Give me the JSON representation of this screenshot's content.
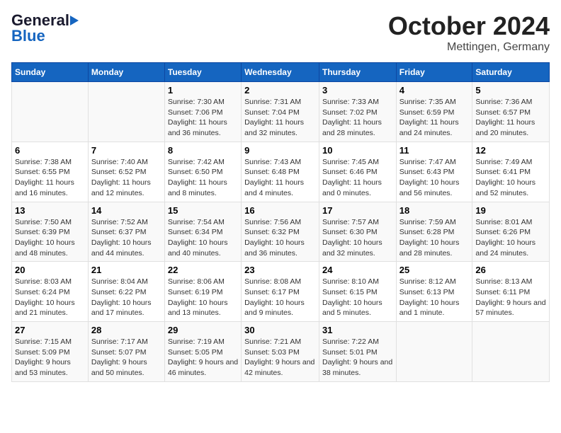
{
  "header": {
    "logo": {
      "general": "General",
      "blue": "Blue"
    },
    "month": "October 2024",
    "location": "Mettingen, Germany"
  },
  "days_of_week": [
    "Sunday",
    "Monday",
    "Tuesday",
    "Wednesday",
    "Thursday",
    "Friday",
    "Saturday"
  ],
  "weeks": [
    [
      {
        "day": "",
        "info": ""
      },
      {
        "day": "",
        "info": ""
      },
      {
        "day": "1",
        "info": "Sunrise: 7:30 AM\nSunset: 7:06 PM\nDaylight: 11 hours and 36 minutes."
      },
      {
        "day": "2",
        "info": "Sunrise: 7:31 AM\nSunset: 7:04 PM\nDaylight: 11 hours and 32 minutes."
      },
      {
        "day": "3",
        "info": "Sunrise: 7:33 AM\nSunset: 7:02 PM\nDaylight: 11 hours and 28 minutes."
      },
      {
        "day": "4",
        "info": "Sunrise: 7:35 AM\nSunset: 6:59 PM\nDaylight: 11 hours and 24 minutes."
      },
      {
        "day": "5",
        "info": "Sunrise: 7:36 AM\nSunset: 6:57 PM\nDaylight: 11 hours and 20 minutes."
      }
    ],
    [
      {
        "day": "6",
        "info": "Sunrise: 7:38 AM\nSunset: 6:55 PM\nDaylight: 11 hours and 16 minutes."
      },
      {
        "day": "7",
        "info": "Sunrise: 7:40 AM\nSunset: 6:52 PM\nDaylight: 11 hours and 12 minutes."
      },
      {
        "day": "8",
        "info": "Sunrise: 7:42 AM\nSunset: 6:50 PM\nDaylight: 11 hours and 8 minutes."
      },
      {
        "day": "9",
        "info": "Sunrise: 7:43 AM\nSunset: 6:48 PM\nDaylight: 11 hours and 4 minutes."
      },
      {
        "day": "10",
        "info": "Sunrise: 7:45 AM\nSunset: 6:46 PM\nDaylight: 11 hours and 0 minutes."
      },
      {
        "day": "11",
        "info": "Sunrise: 7:47 AM\nSunset: 6:43 PM\nDaylight: 10 hours and 56 minutes."
      },
      {
        "day": "12",
        "info": "Sunrise: 7:49 AM\nSunset: 6:41 PM\nDaylight: 10 hours and 52 minutes."
      }
    ],
    [
      {
        "day": "13",
        "info": "Sunrise: 7:50 AM\nSunset: 6:39 PM\nDaylight: 10 hours and 48 minutes."
      },
      {
        "day": "14",
        "info": "Sunrise: 7:52 AM\nSunset: 6:37 PM\nDaylight: 10 hours and 44 minutes."
      },
      {
        "day": "15",
        "info": "Sunrise: 7:54 AM\nSunset: 6:34 PM\nDaylight: 10 hours and 40 minutes."
      },
      {
        "day": "16",
        "info": "Sunrise: 7:56 AM\nSunset: 6:32 PM\nDaylight: 10 hours and 36 minutes."
      },
      {
        "day": "17",
        "info": "Sunrise: 7:57 AM\nSunset: 6:30 PM\nDaylight: 10 hours and 32 minutes."
      },
      {
        "day": "18",
        "info": "Sunrise: 7:59 AM\nSunset: 6:28 PM\nDaylight: 10 hours and 28 minutes."
      },
      {
        "day": "19",
        "info": "Sunrise: 8:01 AM\nSunset: 6:26 PM\nDaylight: 10 hours and 24 minutes."
      }
    ],
    [
      {
        "day": "20",
        "info": "Sunrise: 8:03 AM\nSunset: 6:24 PM\nDaylight: 10 hours and 21 minutes."
      },
      {
        "day": "21",
        "info": "Sunrise: 8:04 AM\nSunset: 6:22 PM\nDaylight: 10 hours and 17 minutes."
      },
      {
        "day": "22",
        "info": "Sunrise: 8:06 AM\nSunset: 6:19 PM\nDaylight: 10 hours and 13 minutes."
      },
      {
        "day": "23",
        "info": "Sunrise: 8:08 AM\nSunset: 6:17 PM\nDaylight: 10 hours and 9 minutes."
      },
      {
        "day": "24",
        "info": "Sunrise: 8:10 AM\nSunset: 6:15 PM\nDaylight: 10 hours and 5 minutes."
      },
      {
        "day": "25",
        "info": "Sunrise: 8:12 AM\nSunset: 6:13 PM\nDaylight: 10 hours and 1 minute."
      },
      {
        "day": "26",
        "info": "Sunrise: 8:13 AM\nSunset: 6:11 PM\nDaylight: 9 hours and 57 minutes."
      }
    ],
    [
      {
        "day": "27",
        "info": "Sunrise: 7:15 AM\nSunset: 5:09 PM\nDaylight: 9 hours and 53 minutes."
      },
      {
        "day": "28",
        "info": "Sunrise: 7:17 AM\nSunset: 5:07 PM\nDaylight: 9 hours and 50 minutes."
      },
      {
        "day": "29",
        "info": "Sunrise: 7:19 AM\nSunset: 5:05 PM\nDaylight: 9 hours and 46 minutes."
      },
      {
        "day": "30",
        "info": "Sunrise: 7:21 AM\nSunset: 5:03 PM\nDaylight: 9 hours and 42 minutes."
      },
      {
        "day": "31",
        "info": "Sunrise: 7:22 AM\nSunset: 5:01 PM\nDaylight: 9 hours and 38 minutes."
      },
      {
        "day": "",
        "info": ""
      },
      {
        "day": "",
        "info": ""
      }
    ]
  ]
}
